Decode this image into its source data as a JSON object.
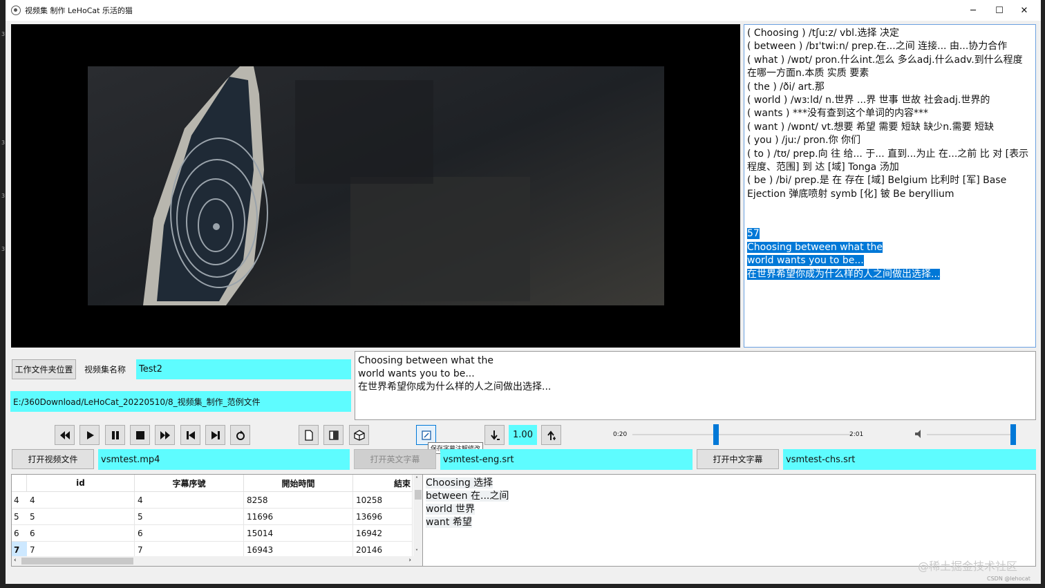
{
  "window": {
    "title": "视频集 制作  LeHoCat 乐活的猫",
    "minimize": "─",
    "maximize": "☐",
    "close": "✕"
  },
  "dictionary_lines": [
    "( Choosing ) /tʃuːz/  vbl.选择 决定",
    "( between ) /bɪ'twiːn/   prep.在...之间 连接... 由...协力合作",
    "( what ) /wɒt/   pron.什么int.怎么 多么adj.什么adv.到什么程度 在哪一方面n.本质 实质 要素",
    "( the ) /ði/   art.那",
    "( world ) /wɜːld/  n.世界 ...界 世事 世故 社会adj.世界的",
    "( wants )  ***没有查到这个单词的内容***",
    "( want ) /wɒnt/  vt.想要 希望 需要 短缺 缺少n.需要 短缺",
    "( you ) /juː/   pron.你 你们",
    "( to ) /tʊ/   prep.向 往 给... 于... 直到...为止 在...之前 比 对 [表示程度、范围] 到 达 [域] Tonga  汤加",
    "( be ) /bi/   prep.是 在 存在 [域] Belgium  比利时 [军] Base Ejection 弹底喷射 symb [化] 铍 Be beryllium"
  ],
  "dictionary_selection": [
    "57",
    "Choosing between what the",
    "world wants you to be...",
    "在世界希望你成为什么样的人之间做出选择..."
  ],
  "workspace": {
    "folder_button": "工作文件夹位置",
    "name_label": "视频集名称",
    "name_value": "Test2",
    "path_value": "E:/360Download/LeHoCat_20220510/8_视频集_制作_范例文件"
  },
  "subtitle_preview": [
    "Choosing between what the",
    "world wants you to be...",
    "在世界希望你成为什么样的人之间做出选择..."
  ],
  "playback": {
    "rate": "1.00",
    "time_start": "0:20",
    "time_end": "2:01",
    "progress": 0.38,
    "volume": 1.0,
    "tooltip": "保存字幕注解修改"
  },
  "icons": {
    "rewind": "rewind-icon",
    "play": "play-icon",
    "pause": "pause-icon",
    "stop": "stop-icon",
    "forward": "fast-forward-icon",
    "prev": "previous-frame-icon",
    "next": "next-frame-icon",
    "loop": "loop-icon",
    "new": "new-file-icon",
    "book": "book-icon",
    "box": "package-icon",
    "note": "edit-note-icon",
    "slower": "slower-icon",
    "faster": "faster-icon",
    "volume": "speaker-icon"
  },
  "files": {
    "open_video": "打开视频文件",
    "video_file": "vsmtest.mp4",
    "open_eng": "打开英文字幕",
    "eng_file": "vsmtest-eng.srt",
    "open_chs": "打开中文字幕",
    "chs_file": "vsmtest-chs.srt"
  },
  "table": {
    "columns": [
      "id",
      "字幕序號",
      "開始時間",
      "結束"
    ],
    "rows": [
      {
        "hdr": "4",
        "id": "4",
        "seq": "4",
        "start": "8258",
        "end": "10258"
      },
      {
        "hdr": "5",
        "id": "5",
        "seq": "5",
        "start": "11696",
        "end": "13696"
      },
      {
        "hdr": "6",
        "id": "6",
        "seq": "6",
        "start": "15014",
        "end": "16942"
      },
      {
        "hdr": "7",
        "id": "7",
        "seq": "7",
        "start": "16943",
        "end": "20146"
      }
    ]
  },
  "annotations": [
    "Choosing 选择",
    "between 在...之间",
    "world 世界",
    "want 希望"
  ],
  "watermark": "@稀土掘金技术社区",
  "watermark_small": "CSDN @lehocat",
  "left_markers": [
    "3",
    "3",
    "3",
    "3"
  ]
}
